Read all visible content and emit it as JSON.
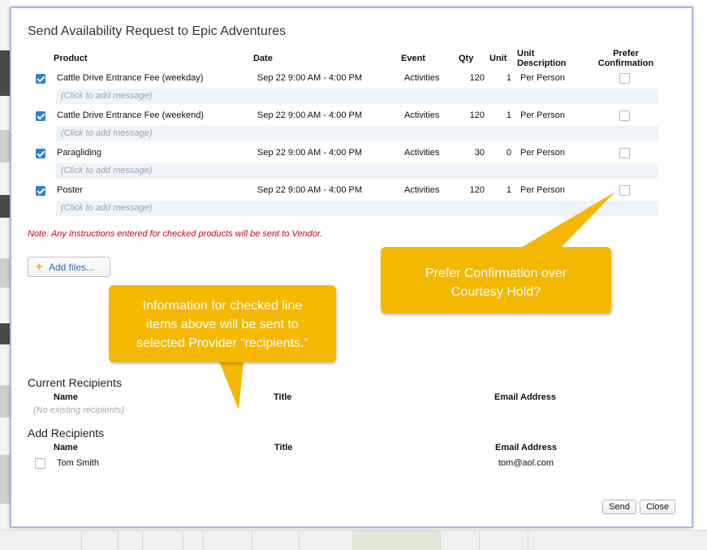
{
  "dialog": {
    "title": "Send Availability Request to Epic Adventures",
    "headers": {
      "product": "Product",
      "date": "Date",
      "event": "Event",
      "qty": "Qty",
      "unit": "Unit",
      "unit_description": [
        "Unit",
        "Description"
      ],
      "prefer_confirmation": [
        "Prefer",
        "Confirmation"
      ]
    },
    "rows": [
      {
        "product": "Cattle Drive Entrance Fee (weekday)",
        "date": "Sep 22 9:00 AM - 4:00 PM",
        "event": "Activities",
        "qty": "120",
        "unit": "1",
        "unit_desc": "Per Person",
        "checked": true,
        "message_placeholder": "(Click to add message)"
      },
      {
        "product": "Cattle Drive Entrance Fee (weekend)",
        "date": "Sep 22 9:00 AM - 4:00 PM",
        "event": "Activities",
        "qty": "120",
        "unit": "1",
        "unit_desc": "Per Person",
        "checked": true,
        "message_placeholder": "(Click to add message)"
      },
      {
        "product": "Paragliding",
        "date": "Sep 22 9:00 AM - 4:00 PM",
        "event": "Activities",
        "qty": "30",
        "unit": "0",
        "unit_desc": "Per Person",
        "checked": true,
        "message_placeholder": "(Click to add message)"
      },
      {
        "product": "Poster",
        "date": "Sep 22 9:00 AM - 4:00 PM",
        "event": "Activities",
        "qty": "120",
        "unit": "1",
        "unit_desc": "Per Person",
        "checked": true,
        "message_placeholder": "(Click to add message)"
      }
    ],
    "note": "Note: Any Instructions entered for checked products will be sent to Vendor.",
    "add_files_label": "Add files...",
    "current_recipients": {
      "heading": "Current Recipients",
      "col_name": "Name",
      "col_title": "Title",
      "col_email": "Email Address",
      "empty_text": "(No existing recipients)"
    },
    "add_recipients": {
      "heading": "Add Recipients",
      "col_name": "Name",
      "col_title": "Title",
      "col_email": "Email Address",
      "rows": [
        {
          "name": "Tom Smith",
          "title": "",
          "email": "tom@aol.com",
          "checked": false
        }
      ]
    },
    "buttons": {
      "send": "Send",
      "close": "Close"
    }
  },
  "callouts": {
    "prefer": [
      "Prefer Confirmation over",
      "Courtesy Hold?"
    ],
    "info": [
      "Information for checked line",
      "items above will be sent to",
      "selected Provider “recipients.”"
    ],
    "color": "#f5b800"
  }
}
